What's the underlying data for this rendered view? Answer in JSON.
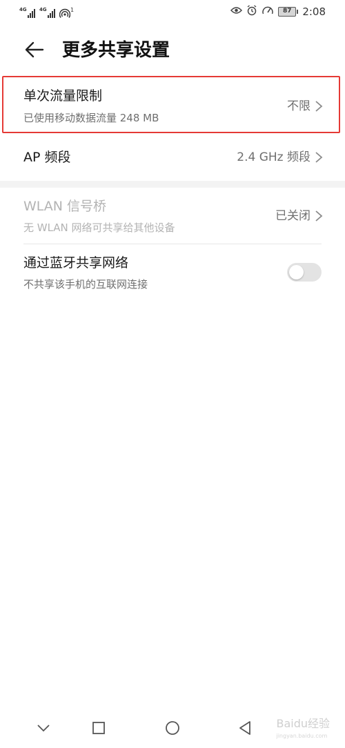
{
  "status_bar": {
    "signal_1_tag": "4G",
    "signal_2_tag": "4G",
    "hotspot_count": "1",
    "battery": "87",
    "time": "2:08",
    "icons": [
      "signal-icon",
      "signal-icon",
      "hotspot-icon",
      "eye-icon",
      "alarm-icon",
      "speedometer-icon",
      "battery-icon"
    ]
  },
  "header": {
    "title": "更多共享设置",
    "back_icon": "back-arrow-icon"
  },
  "settings": {
    "data_limit": {
      "title": "单次流量限制",
      "subtitle": "已使用移动数据流量 248 MB",
      "value": "不限"
    },
    "ap_band": {
      "title": "AP 频段",
      "value": "2.4 GHz 频段"
    },
    "wlan_bridge": {
      "title": "WLAN 信号桥",
      "subtitle": "无 WLAN 网络可共享给其他设备",
      "value": "已关闭"
    },
    "bluetooth_share": {
      "title": "通过蓝牙共享网络",
      "subtitle": "不共享该手机的互联网连接",
      "enabled": false
    }
  },
  "highlight_color": "#e53935",
  "nav_bar": {
    "icons": [
      "chevron-down-icon",
      "recents-icon",
      "home-icon",
      "back-icon"
    ]
  },
  "watermark": {
    "text": "Baidu经验",
    "small": "jingyan.baidu.com"
  }
}
